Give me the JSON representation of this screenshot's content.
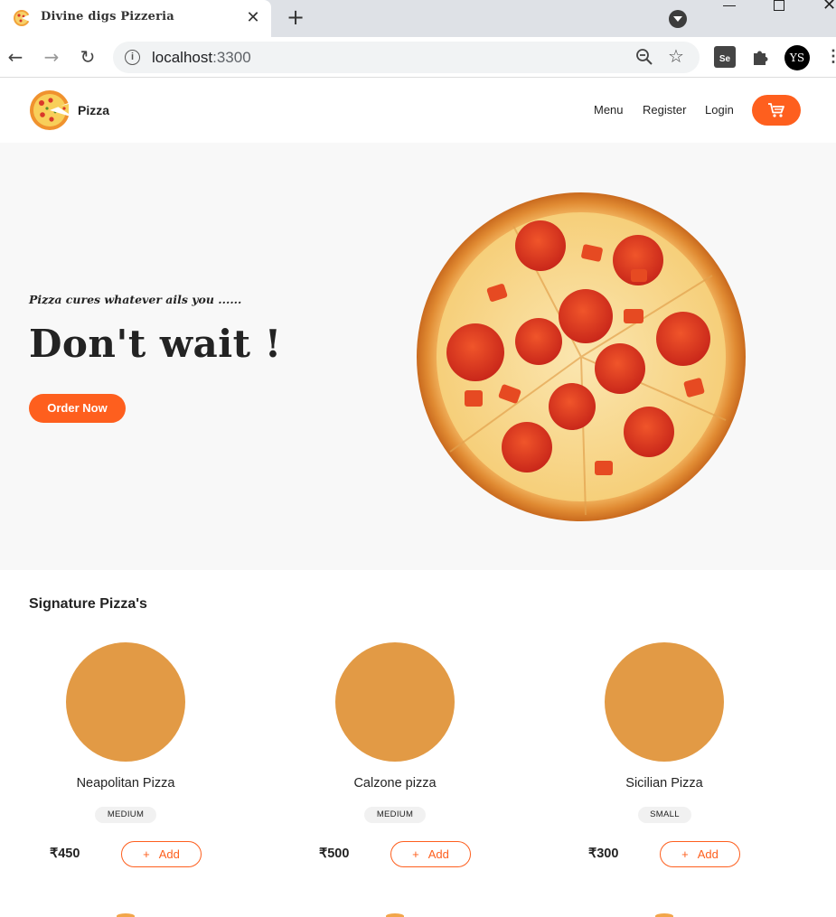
{
  "browser": {
    "tab_title": "Divine digs Pizzeria",
    "close_glyph": "✕",
    "new_tab_glyph": "+",
    "url_host": "localhost",
    "url_port": ":3300",
    "info_glyph": "i",
    "back_glyph": "←",
    "forward_glyph": "→",
    "reload_glyph": "↻",
    "star_glyph": "☆",
    "menu_glyph": "⋮",
    "selenium_label": "Se",
    "avatar_label": "YS"
  },
  "header": {
    "brand": "Pizza",
    "nav": [
      "Menu",
      "Register",
      "Login"
    ]
  },
  "hero": {
    "tagline": "Pizza cures whatever ails you ......",
    "title": "Don't wait !",
    "cta": "Order Now"
  },
  "menu": {
    "title": "Signature Pizza's",
    "add_label": "Add",
    "add_plus": "+",
    "items": [
      {
        "name": "Neapolitan Pizza",
        "size": "MEDIUM",
        "price": "₹450"
      },
      {
        "name": "Calzone pizza",
        "size": "MEDIUM",
        "price": "₹500"
      },
      {
        "name": "Sicilian Pizza",
        "size": "SMALL",
        "price": "₹300"
      }
    ]
  },
  "colors": {
    "accent": "#fe5f1e",
    "hero_bg": "#f8f8f8",
    "text": "#232323"
  }
}
